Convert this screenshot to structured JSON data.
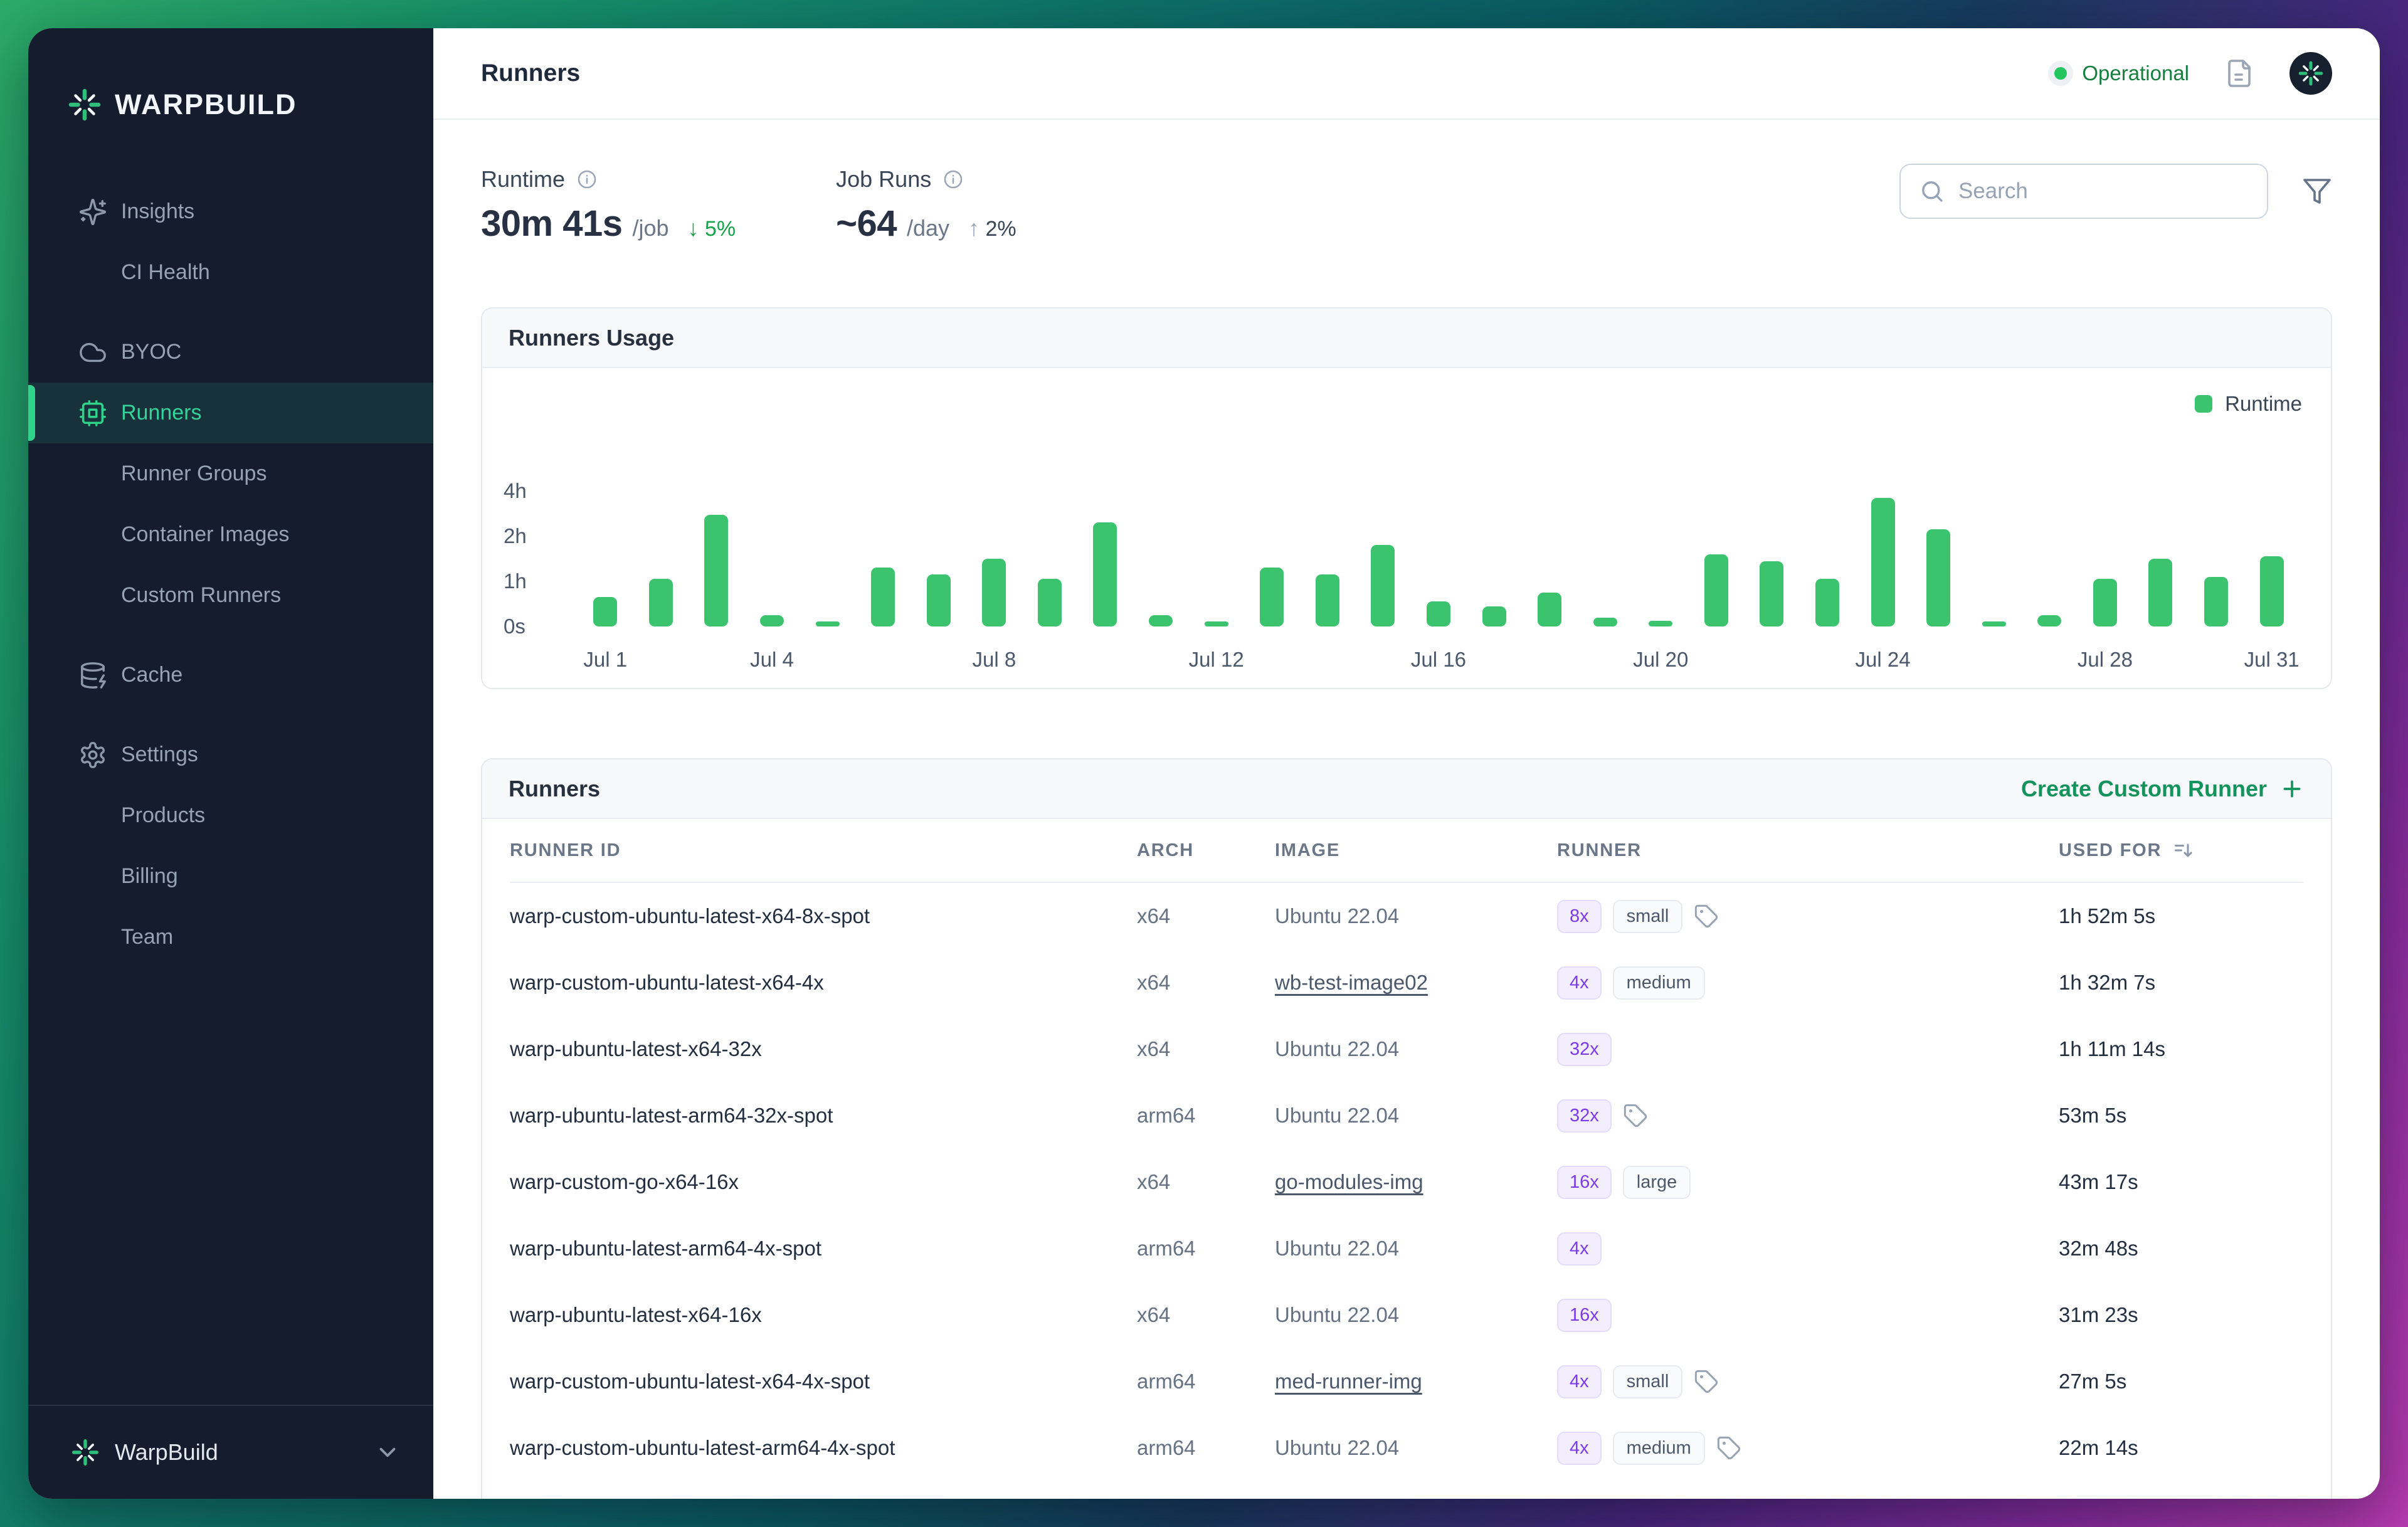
{
  "colors": {
    "accent_green": "#16a34a",
    "chart_bar": "#3cc36e",
    "badge_purple": "#7c3aed",
    "sidebar_bg": "#141c2e",
    "frame_gradient": [
      "#2cab67",
      "#0e7268",
      "#4b2580",
      "#b93bb0"
    ]
  },
  "sidebar": {
    "logo_text": "WARPBUILD",
    "nav": [
      {
        "label": "Insights",
        "icon": "sparkles-icon",
        "sub": false,
        "gap": false,
        "active": false
      },
      {
        "label": "CI Health",
        "icon": "",
        "sub": true,
        "gap": false,
        "active": false
      },
      {
        "label": "BYOC",
        "icon": "cloud-icon",
        "sub": false,
        "gap": true,
        "active": false
      },
      {
        "label": "Runners",
        "icon": "cpu-icon",
        "sub": false,
        "gap": false,
        "active": true
      },
      {
        "label": "Runner Groups",
        "icon": "",
        "sub": true,
        "gap": false,
        "active": false
      },
      {
        "label": "Container Images",
        "icon": "",
        "sub": true,
        "gap": false,
        "active": false
      },
      {
        "label": "Custom Runners",
        "icon": "",
        "sub": true,
        "gap": false,
        "active": false
      },
      {
        "label": "Cache",
        "icon": "database-zap-icon",
        "sub": false,
        "gap": true,
        "active": false
      },
      {
        "label": "Settings",
        "icon": "gear-icon",
        "sub": false,
        "gap": true,
        "active": false
      },
      {
        "label": "Products",
        "icon": "",
        "sub": true,
        "gap": false,
        "active": false
      },
      {
        "label": "Billing",
        "icon": "",
        "sub": true,
        "gap": false,
        "active": false
      },
      {
        "label": "Team",
        "icon": "",
        "sub": true,
        "gap": false,
        "active": false
      }
    ],
    "footer": {
      "label": "WarpBuild"
    }
  },
  "header": {
    "title": "Runners",
    "status": "Operational"
  },
  "stats": [
    {
      "label": "Runtime",
      "value": "30m 41s",
      "unit": "/job",
      "delta": "5%",
      "direction": "down",
      "tone": "good"
    },
    {
      "label": "Job Runs",
      "value": "~64",
      "unit": "/day",
      "delta": "2%",
      "direction": "up",
      "tone": "neutral"
    }
  ],
  "search": {
    "placeholder": "Search"
  },
  "usage_card": {
    "title": "Runners Usage",
    "legend": "Runtime"
  },
  "chart_data": {
    "type": "bar",
    "title": "Runners Usage",
    "legend": [
      "Runtime"
    ],
    "categories": [
      "Jul 1",
      "Jul 2",
      "Jul 3",
      "Jul 4",
      "Jul 5",
      "Jul 6",
      "Jul 7",
      "Jul 8",
      "Jul 9",
      "Jul 10",
      "Jul 11",
      "Jul 12",
      "Jul 13",
      "Jul 14",
      "Jul 15",
      "Jul 16",
      "Jul 17",
      "Jul 18",
      "Jul 19",
      "Jul 20",
      "Jul 21",
      "Jul 22",
      "Jul 23",
      "Jul 24",
      "Jul 25",
      "Jul 26",
      "Jul 27",
      "Jul 28",
      "Jul 29",
      "Jul 30",
      "Jul 31"
    ],
    "values_hours": [
      0.65,
      1.05,
      2.95,
      0.25,
      0.1,
      1.3,
      1.15,
      1.5,
      1.05,
      2.6,
      0.25,
      0.08,
      1.3,
      1.15,
      1.8,
      0.55,
      0.45,
      0.75,
      0.2,
      0.12,
      1.6,
      1.45,
      1.05,
      3.7,
      2.3,
      0.1,
      0.25,
      1.05,
      1.5,
      1.1,
      1.55
    ],
    "ylabel": "",
    "xlabel": "",
    "y_ticks": [
      "0s",
      "1h",
      "2h",
      "4h"
    ],
    "y_tick_hours": [
      0,
      1,
      2,
      4
    ],
    "x_ticks_shown": [
      "Jul 1",
      "Jul 4",
      "Jul 8",
      "Jul 12",
      "Jul 16",
      "Jul 20",
      "Jul 24",
      "Jul 28",
      "Jul 31"
    ],
    "bar_color": "#3cc36e",
    "grid": false,
    "legend_position": "top-right"
  },
  "table_card": {
    "title": "Runners",
    "action_label": "Create Custom Runner",
    "columns": [
      "RUNNER ID",
      "ARCH",
      "IMAGE",
      "RUNNER",
      "USED FOR"
    ],
    "rows": [
      {
        "id": "warp-custom-ubuntu-latest-x64-8x-spot",
        "arch": "x64",
        "image": "Ubuntu 22.04",
        "image_link": false,
        "cpu": "8x",
        "size": "small",
        "tag": true,
        "used": "1h 52m 5s"
      },
      {
        "id": "warp-custom-ubuntu-latest-x64-4x",
        "arch": "x64",
        "image": "wb-test-image02",
        "image_link": true,
        "cpu": "4x",
        "size": "medium",
        "tag": false,
        "used": "1h 32m 7s"
      },
      {
        "id": "warp-ubuntu-latest-x64-32x",
        "arch": "x64",
        "image": "Ubuntu 22.04",
        "image_link": false,
        "cpu": "32x",
        "size": "",
        "tag": false,
        "used": "1h 11m 14s"
      },
      {
        "id": "warp-ubuntu-latest-arm64-32x-spot",
        "arch": "arm64",
        "image": "Ubuntu 22.04",
        "image_link": false,
        "cpu": "32x",
        "size": "",
        "tag": true,
        "used": "53m 5s"
      },
      {
        "id": "warp-custom-go-x64-16x",
        "arch": "x64",
        "image": "go-modules-img",
        "image_link": true,
        "cpu": "16x",
        "size": "large",
        "tag": false,
        "used": "43m 17s"
      },
      {
        "id": "warp-ubuntu-latest-arm64-4x-spot",
        "arch": "arm64",
        "image": "Ubuntu 22.04",
        "image_link": false,
        "cpu": "4x",
        "size": "",
        "tag": false,
        "used": "32m 48s"
      },
      {
        "id": "warp-ubuntu-latest-x64-16x",
        "arch": "x64",
        "image": "Ubuntu 22.04",
        "image_link": false,
        "cpu": "16x",
        "size": "",
        "tag": false,
        "used": "31m 23s"
      },
      {
        "id": "warp-custom-ubuntu-latest-x64-4x-spot",
        "arch": "arm64",
        "image": "med-runner-img",
        "image_link": true,
        "cpu": "4x",
        "size": "small",
        "tag": true,
        "used": "27m 5s"
      },
      {
        "id": "warp-custom-ubuntu-latest-arm64-4x-spot",
        "arch": "arm64",
        "image": "Ubuntu 22.04",
        "image_link": false,
        "cpu": "4x",
        "size": "medium",
        "tag": true,
        "used": "22m 14s"
      }
    ]
  }
}
